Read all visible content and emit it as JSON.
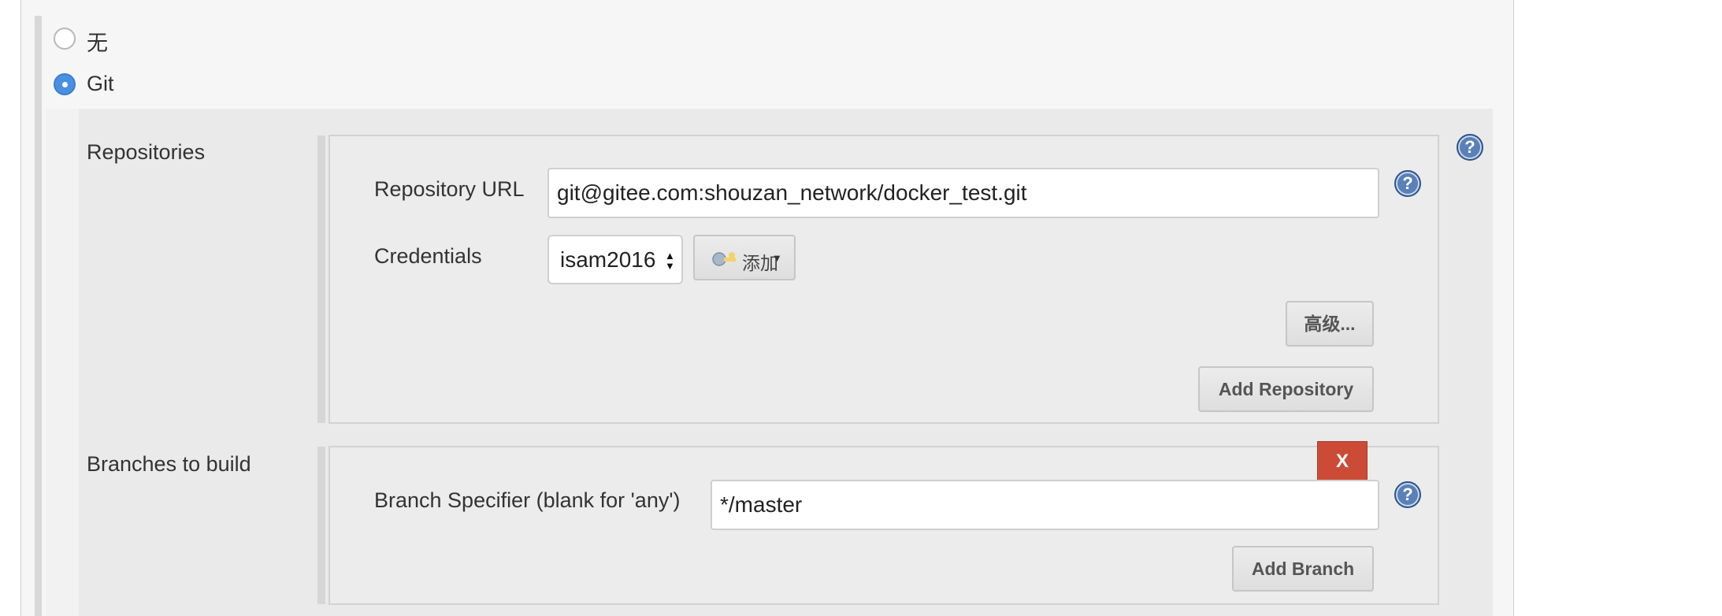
{
  "scm": {
    "options": [
      {
        "label": "无",
        "selected": false
      },
      {
        "label": "Git",
        "selected": true
      }
    ]
  },
  "repositories": {
    "section_label": "Repositories",
    "url_label": "Repository URL",
    "url_value": "git@gitee.com:shouzan_network/docker_test.git",
    "credentials_label": "Credentials",
    "credentials_value": "isam2016",
    "add_label": "添加",
    "advanced_label": "高级...",
    "add_repository_label": "Add Repository"
  },
  "branches": {
    "section_label": "Branches to build",
    "specifier_label": "Branch Specifier (blank for 'any')",
    "specifier_value": "*/master",
    "delete_label": "X",
    "add_branch_label": "Add Branch"
  },
  "icons": {
    "help": "help-icon",
    "radio": "radio-icon",
    "key": "key-icon",
    "dropdown": "dropdown-arrow-icon"
  },
  "colors": {
    "delete_button": "#cc4b37",
    "radio_selected": "#4a90e2",
    "help_icon": "#5a80b8"
  }
}
